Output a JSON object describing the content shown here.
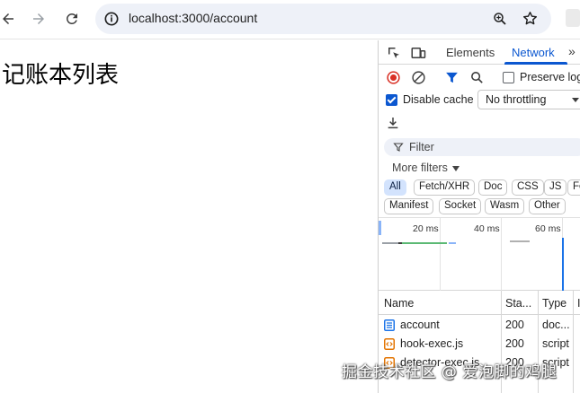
{
  "browser": {
    "url": "localhost:3000/account",
    "icons": [
      "back-icon",
      "forward-icon",
      "reload-icon",
      "site-info-icon",
      "zoom-icon",
      "bookmark-star-icon",
      "extension-icon"
    ]
  },
  "page": {
    "heading": "记账本列表"
  },
  "devtools": {
    "tabs": [
      {
        "label": "Elements"
      },
      {
        "label": "Network"
      }
    ],
    "toolbar": {
      "preserve_log_label": "Preserve log",
      "disable_cache_label": "Disable cache",
      "throttling_value": "No throttling"
    },
    "filter": {
      "placeholder": "Filter",
      "more_filters_label": "More filters"
    },
    "type_filters": {
      "row1": [
        "All",
        "Fetch/XHR",
        "Doc",
        "CSS",
        "JS",
        "Fo"
      ],
      "row2": [
        "Manifest",
        "Socket",
        "Wasm",
        "Other"
      ]
    },
    "timeline": {
      "ticks": [
        "20 ms",
        "40 ms",
        "60 ms"
      ]
    },
    "table": {
      "columns": {
        "name": "Name",
        "status": "Sta...",
        "type": "Type",
        "extra": "I"
      },
      "rows": [
        {
          "name": "account",
          "status": "200",
          "type": "doc...",
          "icon": "document-icon"
        },
        {
          "name": "hook-exec.js",
          "status": "200",
          "type": "script",
          "icon": "script-icon"
        },
        {
          "name": "detector-exec.js",
          "status": "200",
          "type": "script",
          "icon": "script-icon"
        }
      ]
    }
  },
  "watermark": "掘金技术社区 @ 爱泡脚的鸡腿",
  "colors": {
    "accent": "#0b57d0",
    "record_red": "#d93025",
    "chip_active_bg": "#d3e3fd",
    "omnibox_bg": "#eef1f8"
  }
}
